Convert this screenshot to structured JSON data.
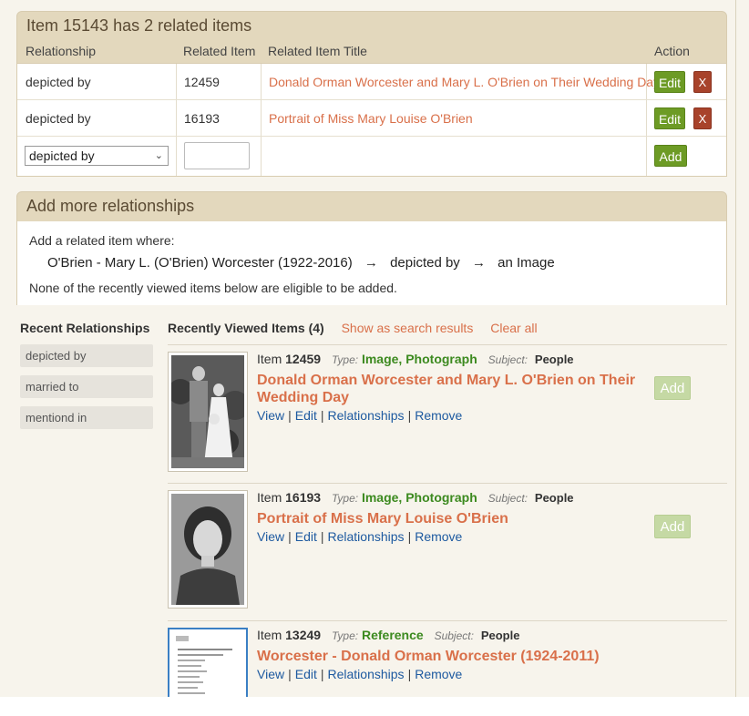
{
  "related": {
    "title": "Item 15143 has 2 related items",
    "headers": {
      "relationship": "Relationship",
      "related_item": "Related Item",
      "title": "Related Item Title",
      "action": "Action"
    },
    "rows": [
      {
        "relationship": "depicted by",
        "item": "12459",
        "title": "Donald Orman Worcester and Mary L. O'Brien on Their Wedding Day",
        "edit": "Edit",
        "remove": "X"
      },
      {
        "relationship": "depicted by",
        "item": "16193",
        "title": "Portrait of Miss Mary Louise O'Brien",
        "edit": "Edit",
        "remove": "X"
      }
    ],
    "new_row": {
      "select_value": "depicted by",
      "input_value": "",
      "add": "Add"
    }
  },
  "more": {
    "title": "Add more relationships",
    "intro": "Add a related item where:",
    "subject": "O'Brien - Mary L. (O'Brien) Worcester (1922-2016)",
    "arrow": "→",
    "relation": "depicted by",
    "object": "an Image",
    "note": "None of the recently viewed items below are eligible to be added."
  },
  "sidebar": {
    "heading": "Recent Relationships",
    "items": [
      "depicted by",
      "married to",
      "mentiond in"
    ]
  },
  "recent": {
    "heading": "Recently Viewed Items (4)",
    "show_search": "Show as search results",
    "clear_all": "Clear all",
    "item_label": "Item",
    "type_label": "Type:",
    "subject_label": "Subject:",
    "actions": {
      "view": "View",
      "edit": "Edit",
      "relationships": "Relationships",
      "remove": "Remove",
      "sep": "|"
    },
    "add": "Add",
    "items": [
      {
        "number": "12459",
        "type": "Image, Photograph",
        "subject": "People",
        "title": "Donald Orman Worcester and Mary L. O'Brien on Their Wedding Day"
      },
      {
        "number": "16193",
        "type": "Image, Photograph",
        "subject": "People",
        "title": "Portrait of Miss Mary Louise O'Brien"
      },
      {
        "number": "13249",
        "type": "Reference",
        "subject": "People",
        "title": "Worcester - Donald Orman Worcester (1924-2011)"
      }
    ]
  },
  "colors": {
    "panel_header": "#e3d8bd",
    "link": "#d9704a",
    "action_link": "#1e5aa0",
    "edit_button": "#6d9b25",
    "remove_button": "#a8432b",
    "type_value": "#3c8a1f"
  }
}
